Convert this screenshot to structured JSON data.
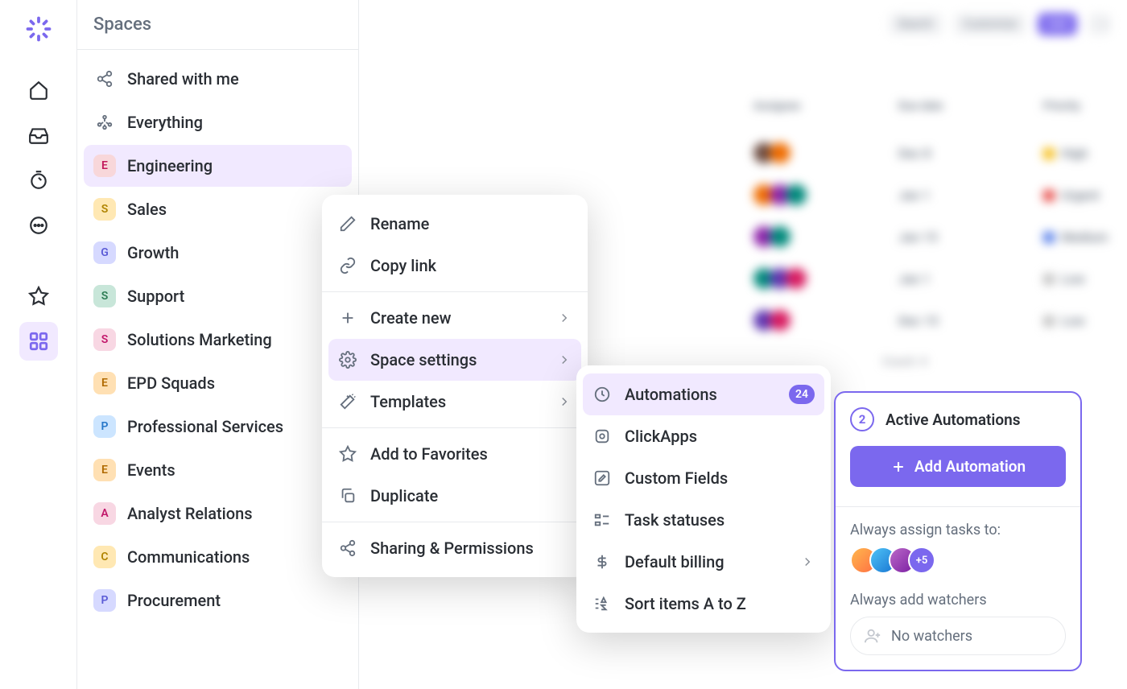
{
  "sidebar": {
    "title": "Spaces",
    "items": [
      {
        "label": "Shared with me",
        "icon": "share-icon"
      },
      {
        "label": "Everything",
        "icon": "network-icon"
      },
      {
        "label": "Engineering",
        "badge": "E",
        "color": "#f8d7da",
        "fg": "#c2185b",
        "active": true
      },
      {
        "label": "Sales",
        "badge": "S",
        "color": "#ffe8b3",
        "fg": "#b08400"
      },
      {
        "label": "Growth",
        "badge": "G",
        "color": "#d6d9ff",
        "fg": "#5b5bd6"
      },
      {
        "label": "Support",
        "badge": "S",
        "color": "#c8e6d9",
        "fg": "#2e7d55"
      },
      {
        "label": "Solutions Marketing",
        "badge": "S",
        "color": "#f8d7e3",
        "fg": "#c2186b"
      },
      {
        "label": "EPD Squads",
        "badge": "E",
        "color": "#ffe0b3",
        "fg": "#b06a00"
      },
      {
        "label": "Professional Services",
        "badge": "P",
        "color": "#cce5ff",
        "fg": "#2878c9"
      },
      {
        "label": "Events",
        "badge": "E",
        "color": "#ffe0b3",
        "fg": "#b06a00"
      },
      {
        "label": "Analyst Relations",
        "badge": "A",
        "color": "#f8d7e3",
        "fg": "#c2186b"
      },
      {
        "label": "Communications",
        "badge": "C",
        "color": "#ffe8b3",
        "fg": "#b08400"
      },
      {
        "label": "Procurement",
        "badge": "P",
        "color": "#d6d9ff",
        "fg": "#5b5bd6"
      }
    ]
  },
  "toolbar": {
    "search_label": "Search",
    "customize_label": "Customize",
    "add_label": "Add"
  },
  "table": {
    "headers": {
      "assignee": "Assignee",
      "due_date": "Due date",
      "priority": "Priority"
    },
    "rows": [
      {
        "due": "Dec 8",
        "priority": "High",
        "pcolor": "#f5b700"
      },
      {
        "due": "Jan 1",
        "priority": "Urgent",
        "pcolor": "#e53935"
      },
      {
        "due": "Jan 15",
        "priority": "Medium",
        "pcolor": "#4974e8"
      },
      {
        "due": "Jan 1",
        "priority": "Low",
        "pcolor": "#bdbdbd"
      },
      {
        "due": "Dec 15",
        "priority": "Low",
        "pcolor": "#bdbdbd"
      }
    ],
    "count_label": "Count: 4"
  },
  "context_menu": {
    "rename": "Rename",
    "copy_link": "Copy link",
    "create_new": "Create new",
    "space_settings": "Space settings",
    "templates": "Templates",
    "add_favorites": "Add to Favorites",
    "duplicate": "Duplicate",
    "sharing": "Sharing & Permissions"
  },
  "sub_menu": {
    "automations": "Automations",
    "automations_count": "24",
    "clickapps": "ClickApps",
    "custom_fields": "Custom Fields",
    "task_statuses": "Task statuses",
    "default_billing": "Default billing",
    "sort_items": "Sort items A to Z"
  },
  "automations_panel": {
    "count": "2",
    "title": "Active Automations",
    "add_button": "Add Automation",
    "assign_label": "Always assign tasks to:",
    "overflow": "+5",
    "watchers_label": "Always add watchers",
    "no_watchers": "No watchers"
  }
}
